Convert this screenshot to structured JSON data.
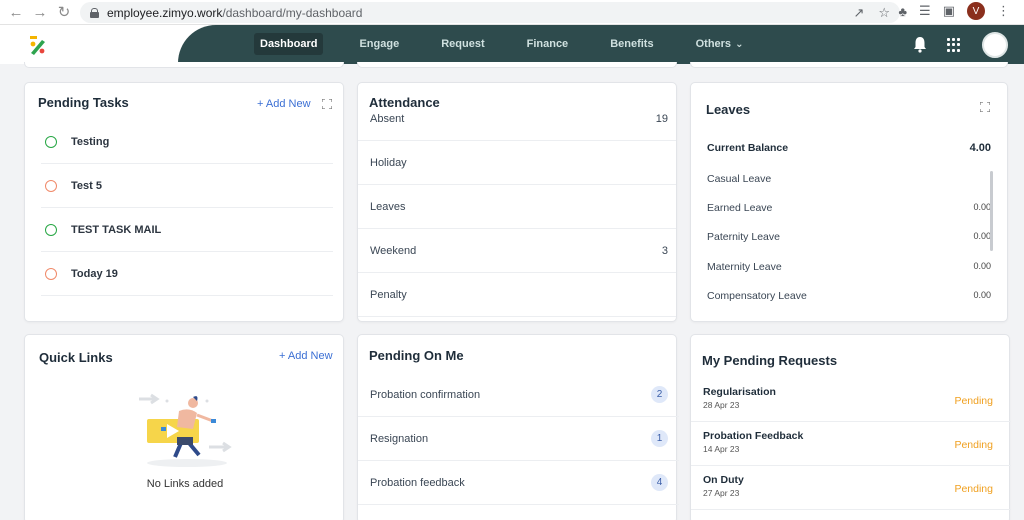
{
  "browser": {
    "url_domain": "employee.zimyo.work",
    "url_path": "/dashboard/my-dashboard",
    "profile_letter": "V"
  },
  "nav": {
    "items": [
      "Dashboard",
      "Engage",
      "Request",
      "Finance",
      "Benefits",
      "Others"
    ],
    "active": "Dashboard"
  },
  "pending_tasks": {
    "title": "Pending Tasks",
    "add_label": "+ Add New",
    "tasks": [
      {
        "label": "Testing",
        "status": "green"
      },
      {
        "label": "Test 5",
        "status": "orange"
      },
      {
        "label": "TEST TASK MAIL",
        "status": "green"
      },
      {
        "label": "Today 19",
        "status": "orange"
      }
    ]
  },
  "attendance": {
    "title": "Attendance",
    "rows": [
      {
        "label": "Absent",
        "value": "19"
      },
      {
        "label": "Holiday",
        "value": ""
      },
      {
        "label": "Leaves",
        "value": ""
      },
      {
        "label": "Weekend",
        "value": "3"
      },
      {
        "label": "Penalty",
        "value": ""
      }
    ]
  },
  "leaves": {
    "title": "Leaves",
    "balance_label": "Current Balance",
    "balance_value": "4.00",
    "rows": [
      {
        "label": "Casual Leave",
        "value": ""
      },
      {
        "label": "Earned Leave",
        "value": "0.00"
      },
      {
        "label": "Paternity Leave",
        "value": "0.00"
      },
      {
        "label": "Maternity Leave",
        "value": "0.00"
      },
      {
        "label": "Compensatory Leave",
        "value": "0.00"
      }
    ]
  },
  "quick_links": {
    "title": "Quick Links",
    "add_label": "+ Add New",
    "empty_text": "No Links added"
  },
  "pending_on_me": {
    "title": "Pending On Me",
    "rows": [
      {
        "label": "Probation confirmation",
        "count": "2"
      },
      {
        "label": "Resignation",
        "count": "1"
      },
      {
        "label": "Probation feedback",
        "count": "4"
      }
    ]
  },
  "my_pending_requests": {
    "title": "My Pending Requests",
    "rows": [
      {
        "title": "Regularisation",
        "date": "28 Apr 23",
        "status": "Pending"
      },
      {
        "title": "Probation Feedback",
        "date": "14 Apr 23",
        "status": "Pending"
      },
      {
        "title": "On Duty",
        "date": "27 Apr 23",
        "status": "Pending"
      }
    ]
  },
  "colors": {
    "header_dark": "#2e4b4d",
    "accent_blue": "#3b6fd4",
    "pending_orange": "#f0a020",
    "task_green": "#28a745",
    "task_orange": "#f08a6a"
  }
}
